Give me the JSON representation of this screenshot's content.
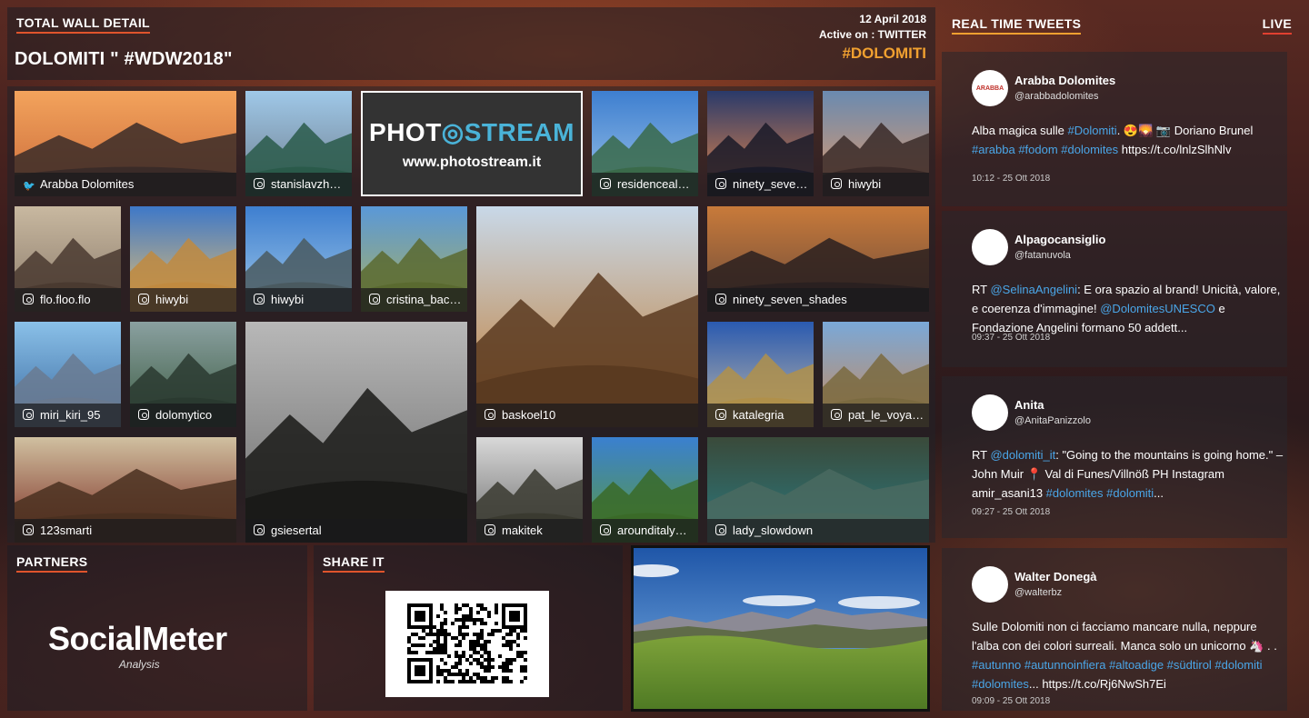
{
  "header": {
    "label": "TOTAL WALL DETAIL",
    "title": "DOLOMITI \" #WDW2018\"",
    "date": "12 April 2018",
    "active": "Active on : TWITTER",
    "hashtag": "#DOLOMITI"
  },
  "logo": {
    "word_a": "PHOT",
    "word_b": "STREAM",
    "url": "www.photostream.it"
  },
  "tiles": [
    {
      "caption": "Arabba Dolomites",
      "source": "twitter"
    },
    {
      "caption": "stanislavzh…",
      "source": "instagram"
    },
    {
      "caption": "residenceal…",
      "source": "instagram"
    },
    {
      "caption": "ninety_seve…",
      "source": "instagram"
    },
    {
      "caption": "hiwybi",
      "source": "instagram"
    },
    {
      "caption": "flo.floo.flo",
      "source": "instagram"
    },
    {
      "caption": "hiwybi",
      "source": "instagram"
    },
    {
      "caption": "hiwybi",
      "source": "instagram"
    },
    {
      "caption": "cristina_bac…",
      "source": "instagram"
    },
    {
      "caption": "ninety_seven_shades",
      "source": "instagram"
    },
    {
      "caption": "miri_kiri_95",
      "source": "instagram"
    },
    {
      "caption": "dolomytico",
      "source": "instagram"
    },
    {
      "caption": "baskoel10",
      "source": "instagram"
    },
    {
      "caption": "katalegria",
      "source": "instagram"
    },
    {
      "caption": "pat_le_voya…",
      "source": "instagram"
    },
    {
      "caption": "123smarti",
      "source": "instagram"
    },
    {
      "caption": "gsiesertal",
      "source": "instagram"
    },
    {
      "caption": "makitek",
      "source": "instagram"
    },
    {
      "caption": "arounditaly…",
      "source": "instagram"
    },
    {
      "caption": "lady_slowdown",
      "source": "instagram"
    }
  ],
  "partners": {
    "label": "PARTNERS",
    "brand_a": "Social",
    "brand_b": "Meter",
    "brand_sub": "Analysis"
  },
  "share": {
    "label": "SHARE IT"
  },
  "tweets_panel": {
    "title": "REAL TIME TWEETS",
    "live": "LIVE"
  },
  "tweets": [
    {
      "name": "Arabba Dolomites",
      "handle": "@arabbadolomites",
      "avatar_text": "ARABBA",
      "parts": [
        {
          "t": "Alba magica sulle "
        },
        {
          "t": "#Dolomiti",
          "hl": true
        },
        {
          "t": ". 😍🌄 📷 Doriano Brunel "
        },
        {
          "t": "#arabba #fodom #dolomites",
          "hl": true
        },
        {
          "t": " https://t.co/lnlzSlhNlv"
        }
      ],
      "time": "10:12 - 25 Ott 2018"
    },
    {
      "name": "Alpagocansiglio",
      "handle": "@fatanuvola",
      "avatar_text": "",
      "parts": [
        {
          "t": "RT "
        },
        {
          "t": "@SelinaAngelini",
          "hl": true
        },
        {
          "t": ": E ora spazio al brand! Unicità, valore, e coerenza d'immagine! "
        },
        {
          "t": "@DolomitesUNESCO",
          "hl": true
        },
        {
          "t": " e Fondazione Angelini formano 50 addett..."
        }
      ],
      "time": "09:37 - 25 Ott 2018"
    },
    {
      "name": "Anita",
      "handle": "@AnitaPanizzolo",
      "avatar_text": "",
      "parts": [
        {
          "t": "RT "
        },
        {
          "t": "@dolomiti_it",
          "hl": true
        },
        {
          "t": ": \"Going to the mountains is going home.\" – John Muir 📍 Val di Funes/Villnöß PH Instagram amir_asani13 "
        },
        {
          "t": "#dolomites #dolomiti",
          "hl": true
        },
        {
          "t": "..."
        }
      ],
      "time": "09:27 - 25 Ott 2018"
    },
    {
      "name": "Walter Donegà",
      "handle": "@walterbz",
      "avatar_text": "",
      "parts": [
        {
          "t": "Sulle Dolomiti non ci facciamo mancare nulla, neppure l'alba con dei colori surreali. Manca solo un unicorno 🦄 . . "
        },
        {
          "t": "#autunno #autunnoinfiera #altoadige #südtirol #dolomiti #dolomites",
          "hl": true
        },
        {
          "t": "... https://t.co/Rj6NwSh7Ei"
        }
      ],
      "time": "09:09 - 25 Ott 2018"
    }
  ],
  "colors": {
    "accent": "#e0542c",
    "hashtag": "#f0a030",
    "link": "#4aa6e8",
    "logo_blue": "#4ab3d8"
  }
}
